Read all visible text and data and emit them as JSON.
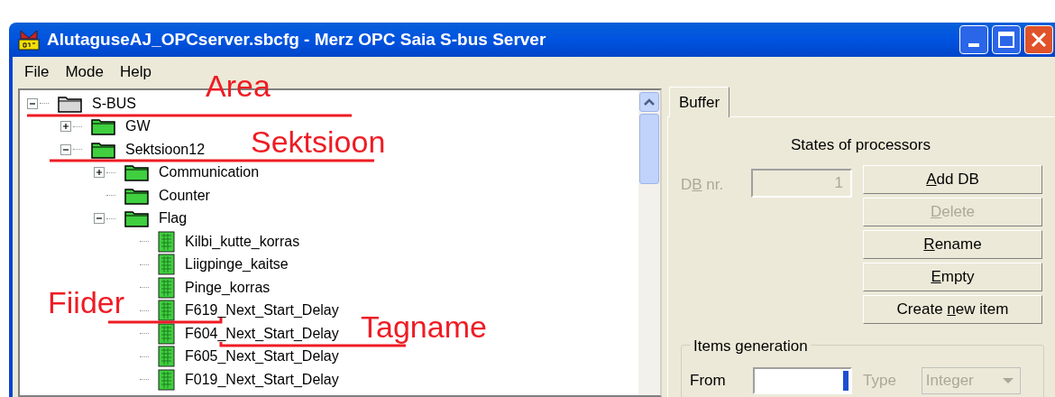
{
  "window": {
    "title": "AlutaguseAJ_OPCserver.sbcfg - Merz OPC Saia S-bus Server"
  },
  "menu": [
    "File",
    "Mode",
    "Help"
  ],
  "tree": [
    {
      "kind": "bus",
      "label": "S-BUS",
      "expanded": true,
      "children": [
        {
          "kind": "folder",
          "label": "GW",
          "expanded": false
        },
        {
          "kind": "folder",
          "label": "Sektsioon12",
          "expanded": true,
          "children": [
            {
              "kind": "folder",
              "label": "Communication",
              "expanded": false
            },
            {
              "kind": "folder",
              "label": "Counter"
            },
            {
              "kind": "folder",
              "label": "Flag",
              "expanded": true,
              "children": [
                {
                  "kind": "tag",
                  "label": "Kilbi_kutte_korras"
                },
                {
                  "kind": "tag",
                  "label": "Liigpinge_kaitse"
                },
                {
                  "kind": "tag",
                  "label": "Pinge_korras"
                },
                {
                  "kind": "tag",
                  "label": "F619_Next_Start_Delay"
                },
                {
                  "kind": "tag",
                  "label": "F604_Next_Start_Delay"
                },
                {
                  "kind": "tag",
                  "label": "F605_Next_Start_Delay"
                },
                {
                  "kind": "tag",
                  "label": "F019_Next_Start_Delay"
                }
              ]
            }
          ]
        }
      ]
    }
  ],
  "annotations": [
    {
      "text": "Area"
    },
    {
      "text": "Sektsioon"
    },
    {
      "text": "Fiider"
    },
    {
      "text": "Tagname"
    }
  ],
  "tabs": [
    {
      "label": "Buffer",
      "selected": true
    }
  ],
  "panel": {
    "heading": "States of processors",
    "db_label": {
      "pre": "D",
      "key": "B",
      "post": " nr.",
      "disabled": true
    },
    "db_field": {
      "value": "1",
      "disabled": true
    },
    "buttons": [
      {
        "key": "A",
        "post": "dd DB",
        "disabled": false
      },
      {
        "key": "D",
        "post": "elete",
        "disabled": true
      },
      {
        "key": "R",
        "post": "ename",
        "disabled": false
      },
      {
        "key": "E",
        "post": "mpty",
        "disabled": false
      },
      {
        "pre": "Create ",
        "key": "n",
        "post": "ew item",
        "disabled": false
      }
    ]
  },
  "items_generation": {
    "title": "Items generation",
    "from_label": "From",
    "type_label": "Type",
    "type_disabled": true,
    "type_value": "Integer"
  }
}
